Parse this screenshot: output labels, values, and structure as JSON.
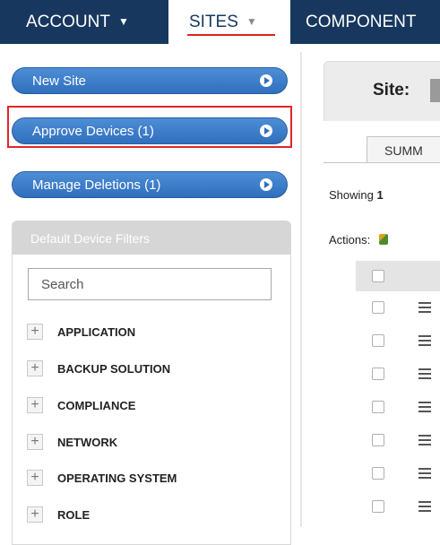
{
  "nav": {
    "account_label": "ACCOUNT",
    "sites_label": "SITES",
    "components_label": "COMPONENT"
  },
  "sidebar": {
    "buttons": [
      {
        "label": "New Site"
      },
      {
        "label": "Approve Devices (1)"
      },
      {
        "label": "Manage Deletions (1)"
      }
    ],
    "filters": {
      "title": "Default Device Filters",
      "search_placeholder": "Search",
      "items": [
        "APPLICATION",
        "BACKUP SOLUTION",
        "COMPLIANCE",
        "NETWORK",
        "OPERATING SYSTEM",
        "ROLE"
      ]
    }
  },
  "main": {
    "site_label": "Site:",
    "tab_summary": "SUMM",
    "showing_label": "Showing",
    "showing_count": "1",
    "actions_label": "Actions:",
    "row_count": 7
  },
  "colors": {
    "nav_bg": "#17375e",
    "button_blue": "#2f6fbd",
    "highlight": "#e0262a",
    "sites_underline": "#d9261c"
  }
}
